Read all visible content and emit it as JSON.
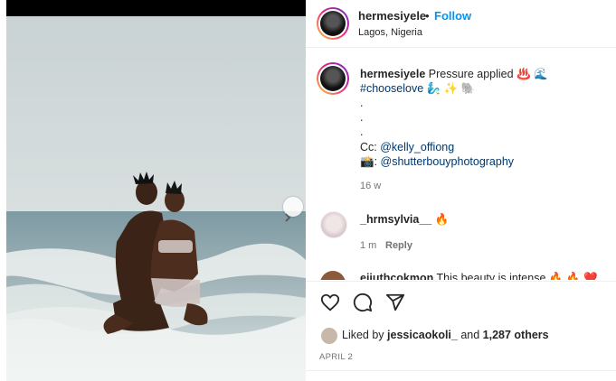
{
  "post": {
    "author": "hermesiyele",
    "follow_label": "Follow",
    "separator": "•",
    "location": "Lagos, Nigeria",
    "caption_text": "Pressure applied ♨️ 🌊",
    "hashtag_line": "#chooselove 🧞‍♂️ ✨ 🐘",
    "dots": [
      ".",
      ".",
      "."
    ],
    "cc_label": "Cc: ",
    "cc_mention": "@kelly_offiong",
    "camera_emoji": "📸",
    "camera_sep": ": ",
    "photographer_mention": "@shutterbouyphotography",
    "caption_time": "16 w"
  },
  "comments": [
    {
      "user": "_hrmsylvia__",
      "emoji": "🔥",
      "time": "1 m",
      "reply_label": "Reply"
    },
    {
      "user": "ejiuthcokmon",
      "text": "This beauty is intense 🔥 🔥 ❤️"
    }
  ],
  "actions": {
    "like": "heart-icon",
    "comment": "comment-icon",
    "share": "share-icon"
  },
  "likes": {
    "prefix": "Liked by ",
    "user": "jessicaokoli_",
    "middle": " and ",
    "count": "1,287 others"
  },
  "date": "APRIL 2",
  "colors": {
    "link": "#00376b",
    "follow": "#0095f6",
    "muted": "#737373"
  }
}
